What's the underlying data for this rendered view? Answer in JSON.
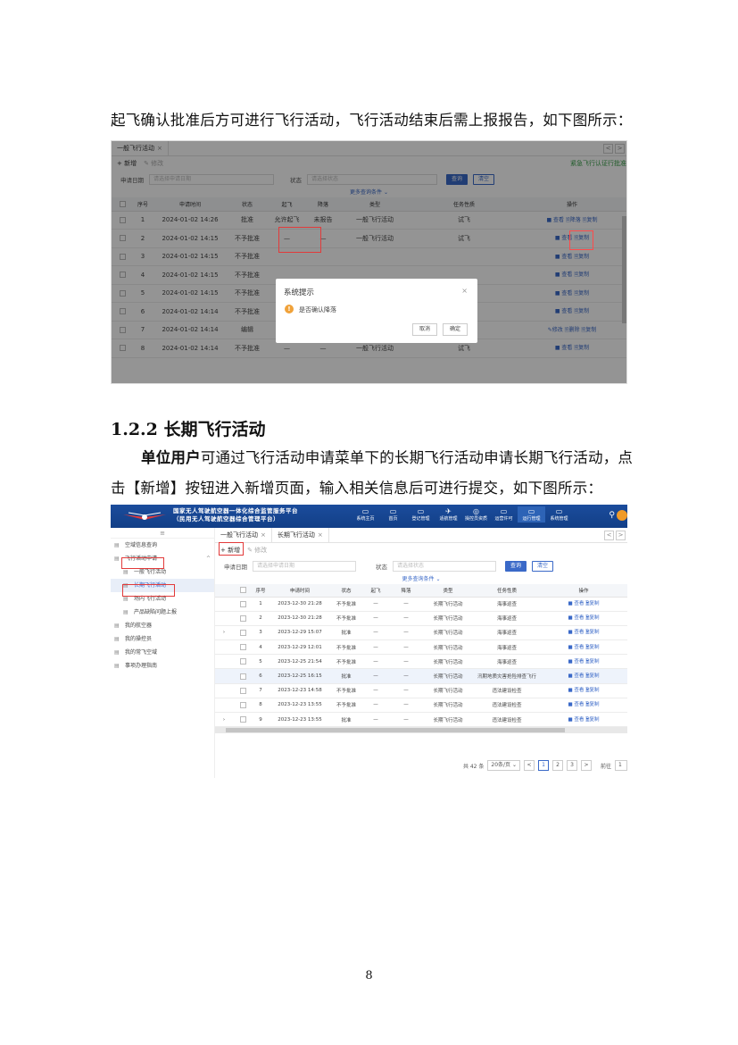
{
  "doc": {
    "para1": "起飞确认批准后方可进行飞行活动，飞行活动结束后需上报报告，如下图所示：",
    "heading": "1.2.2  长期飞行活动",
    "para2_bold": "单位用户",
    "para2_rest": "可通过飞行活动申请菜单下的长期飞行活动申请长期飞行活动，点",
    "para3": "击【新增】按钮进入新增页面，输入相关信息后可进行提交，如下图所示：",
    "page_number": "8"
  },
  "shot1": {
    "tab": "一般飞行活动",
    "tab_close": "×",
    "nav_prev": "<",
    "nav_next": ">",
    "add": "+ 新增",
    "edit": "✎ 修改",
    "right_link": "紧急飞行认证行批准",
    "date_label": "申请日期",
    "date_placeholder": "请选择申请日期",
    "status_label": "状态",
    "status_placeholder": "请选择状态",
    "query": "查询",
    "reset": "清空",
    "more": "更多查询条件 ⌄",
    "columns": [
      "",
      "序号",
      "申请时间",
      "状态",
      "起飞",
      "降落",
      "类型",
      "任务性质",
      "操作"
    ],
    "rows": [
      {
        "no": "1",
        "time": "2024-01-02 14:26",
        "status": "批准",
        "takeoff": "允许起飞",
        "land": "未报告",
        "type": "一般飞行活动",
        "nature": "试飞",
        "ops": "■ 查看  🗎降落  🗎复制"
      },
      {
        "no": "2",
        "time": "2024-01-02 14:15",
        "status": "不予批准",
        "takeoff": "—",
        "land": "—",
        "type": "一般飞行活动",
        "nature": "试飞",
        "ops": "■ 查看  🗎复制"
      },
      {
        "no": "3",
        "time": "2024-01-02 14:15",
        "status": "不予批准",
        "takeoff": "",
        "land": "",
        "type": "",
        "nature": "",
        "ops": "■ 查看  🗎复制"
      },
      {
        "no": "4",
        "time": "2024-01-02 14:15",
        "status": "不予批准",
        "takeoff": "",
        "land": "",
        "type": "",
        "nature": "",
        "ops": "■ 查看  🗎复制"
      },
      {
        "no": "5",
        "time": "2024-01-02 14:15",
        "status": "不予批准",
        "takeoff": "",
        "land": "",
        "type": "",
        "nature": "",
        "ops": "■ 查看  🗎复制"
      },
      {
        "no": "6",
        "time": "2024-01-02 14:14",
        "status": "不予批准",
        "takeoff": "",
        "land": "",
        "type": "",
        "nature": "",
        "ops": "■ 查看  🗎复制"
      },
      {
        "no": "7",
        "time": "2024-01-02 14:14",
        "status": "编辑",
        "takeoff": "—",
        "land": "—",
        "type": "一般飞行活动",
        "nature": "试飞",
        "ops": "✎修改  🗎删除  🗎复制"
      },
      {
        "no": "8",
        "time": "2024-01-02 14:14",
        "status": "不予批准",
        "takeoff": "—",
        "land": "—",
        "type": "一般飞行活动",
        "nature": "试飞",
        "ops": "■ 查看  🗎复制"
      }
    ],
    "dialog": {
      "title": "系统提示",
      "close": "×",
      "icon": "!",
      "message": "是否确认降落",
      "cancel": "取消",
      "ok": "确定"
    }
  },
  "shot2": {
    "system_name_line1": "国家无人驾驶航空器一体化综合监管服务平台",
    "system_name_line2": "（民用无人驾驶航空器综合管理平台）",
    "nav": [
      {
        "icon": "▭",
        "label": "系统主页"
      },
      {
        "icon": "▭",
        "label": "首页"
      },
      {
        "icon": "▭",
        "label": "登记管理"
      },
      {
        "icon": "✈",
        "label": "适航管理"
      },
      {
        "icon": "◎",
        "label": "操控员资质"
      },
      {
        "icon": "▭",
        "label": "运营许可"
      },
      {
        "icon": "▭",
        "label": "运行管理"
      },
      {
        "icon": "▭",
        "label": "系统管理"
      }
    ],
    "search_icon": "⚲",
    "menu_toggle": "≡",
    "side": [
      {
        "label": "空域信息查询",
        "level": 1
      },
      {
        "label": "飞行活动申请",
        "level": 1,
        "arrow": "^"
      },
      {
        "label": "一般飞行活动",
        "level": 2
      },
      {
        "label": "长期飞行活动",
        "level": 2
      },
      {
        "label": "场内飞行活动",
        "level": 2
      },
      {
        "label": "产品缺陷问题上报",
        "level": 2
      },
      {
        "label": "我的航空器",
        "level": 1
      },
      {
        "label": "我的操控员",
        "level": 1
      },
      {
        "label": "我的常飞空域",
        "level": 1
      },
      {
        "label": "事项办理指南",
        "level": 1
      }
    ],
    "tabs": [
      "一般飞行活动",
      "长期飞行活动"
    ],
    "tab_close": "×",
    "nav_prev": "<",
    "nav_next": ">",
    "add": "+ 新增",
    "edit": "✎ 修改",
    "date_label": "申请日期",
    "date_placeholder": "请选择申请日期",
    "status_label": "状态",
    "status_placeholder": "请选择状态",
    "query": "查询",
    "reset": "清空",
    "more": "更多查询条件 ⌄",
    "columns": [
      "",
      "",
      "序号",
      "申请时间",
      "状态",
      "起飞",
      "降落",
      "类型",
      "任务性质",
      "操作"
    ],
    "rows": [
      {
        "exp": "",
        "no": "1",
        "time": "2023-12-30 21:28",
        "status": "不予批准",
        "takeoff": "—",
        "land": "—",
        "type": "长期飞行活动",
        "nature": "海事巡查",
        "ops": "■ 查看  🗎复制"
      },
      {
        "exp": "",
        "no": "2",
        "time": "2023-12-30 21:28",
        "status": "不予批准",
        "takeoff": "—",
        "land": "—",
        "type": "长期飞行活动",
        "nature": "海事巡查",
        "ops": "■ 查看  🗎复制"
      },
      {
        "exp": "›",
        "no": "3",
        "time": "2023-12-29 15:07",
        "status": "批准",
        "takeoff": "—",
        "land": "—",
        "type": "长期飞行活动",
        "nature": "海事巡查",
        "ops": "■ 查看  🗎复制"
      },
      {
        "exp": "",
        "no": "4",
        "time": "2023-12-29 12:01",
        "status": "不予批准",
        "takeoff": "—",
        "land": "—",
        "type": "长期飞行活动",
        "nature": "海事巡查",
        "ops": "■ 查看  🗎复制"
      },
      {
        "exp": "",
        "no": "5",
        "time": "2023-12-25 21:54",
        "status": "不予批准",
        "takeoff": "—",
        "land": "—",
        "type": "长期飞行活动",
        "nature": "海事巡查",
        "ops": "■ 查看  🗎复制"
      },
      {
        "exp": "",
        "no": "6",
        "time": "2023-12-25 16:15",
        "status": "批准",
        "takeoff": "—",
        "land": "—",
        "type": "长期飞行活动",
        "nature": "汛期地质灾害抢险排查飞行",
        "ops": "■ 查看  🗎复制"
      },
      {
        "exp": "",
        "no": "7",
        "time": "2023-12-23 14:58",
        "status": "不予批准",
        "takeoff": "—",
        "land": "—",
        "type": "长期飞行活动",
        "nature": "违法建设检查",
        "ops": "■ 查看  🗎复制"
      },
      {
        "exp": "",
        "no": "8",
        "time": "2023-12-23 13:55",
        "status": "不予批准",
        "takeoff": "—",
        "land": "—",
        "type": "长期飞行活动",
        "nature": "违法建设检查",
        "ops": "■ 查看  🗎复制"
      },
      {
        "exp": "›",
        "no": "9",
        "time": "2023-12-23 13:55",
        "status": "批准",
        "takeoff": "—",
        "land": "—",
        "type": "长期飞行活动",
        "nature": "违法建设检查",
        "ops": "■ 查看  🗎复制"
      }
    ],
    "pager": {
      "total": "共 42 条",
      "size": "20条/页 ⌄",
      "prev": "<",
      "pages": [
        "1",
        "2",
        "3"
      ],
      "next": ">",
      "goto": "前往",
      "goto_value": "1"
    }
  }
}
